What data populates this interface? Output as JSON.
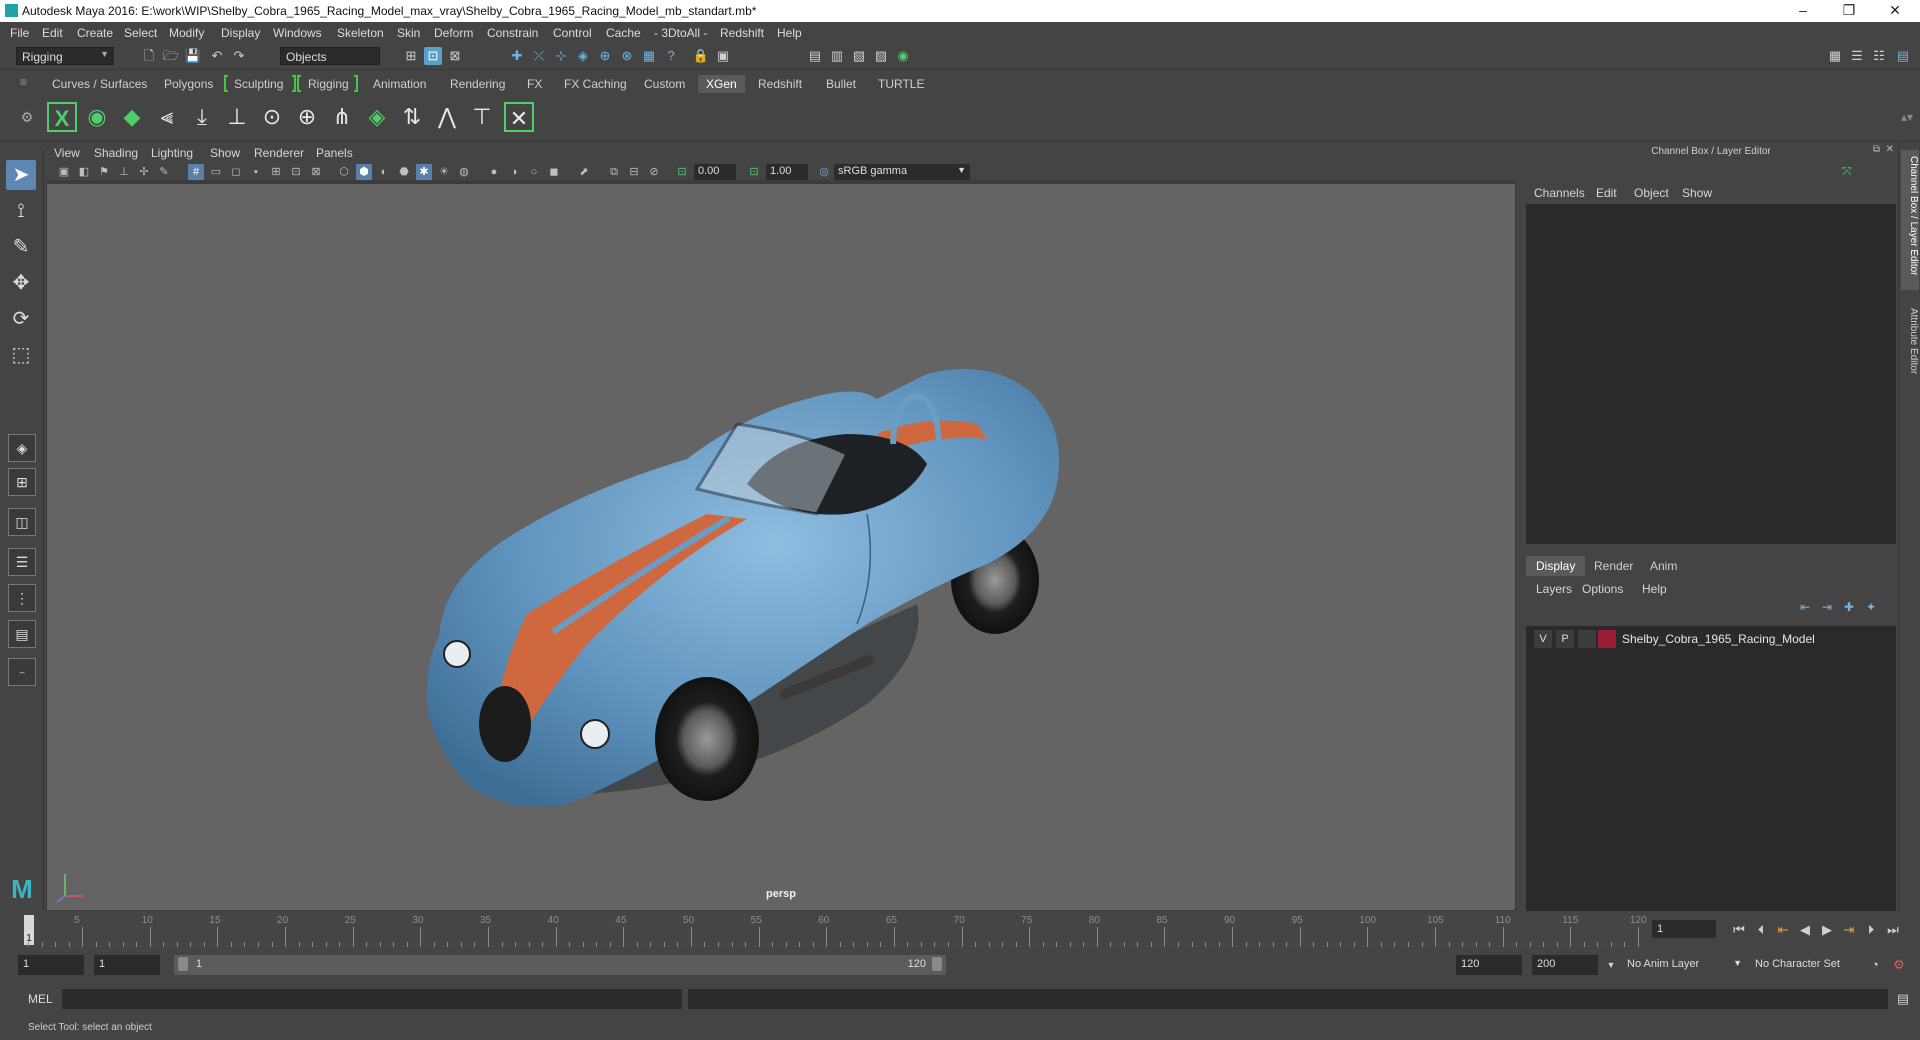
{
  "title": "Autodesk Maya 2016: E:\\work\\WIP\\Shelby_Cobra_1965_Racing_Model_max_vray\\Shelby_Cobra_1965_Racing_Model_mb_standart.mb*",
  "window_controls": {
    "minimize": "–",
    "restore": "❐",
    "close": "✕"
  },
  "menu": [
    "File",
    "Edit",
    "Create",
    "Select",
    "Modify",
    "Display",
    "Windows",
    "Skeleton",
    "Skin",
    "Deform",
    "Constrain",
    "Control",
    "Cache",
    "- 3DtoAll -",
    "Redshift",
    "Help"
  ],
  "statusline": {
    "mode": "Rigging",
    "selection_mode": "Objects"
  },
  "shelf_tabs": [
    "Curves / Surfaces",
    "Polygons",
    "Sculpting",
    "Rigging",
    "Animation",
    "Rendering",
    "FX",
    "FX Caching",
    "Custom",
    "XGen",
    "Redshift",
    "Bullet",
    "TURTLE"
  ],
  "shelf_active": "XGen",
  "panel_menu": [
    "View",
    "Shading",
    "Lighting",
    "Show",
    "Renderer",
    "Panels"
  ],
  "panel_values": {
    "exposure": "0.00",
    "gamma": "1.00",
    "color_space": "sRGB gamma"
  },
  "viewport": {
    "camera": "persp",
    "background": "#646464"
  },
  "right_panel": {
    "title": "Channel Box / Layer Editor",
    "channel_menu": [
      "Channels",
      "Edit",
      "Object",
      "Show"
    ],
    "layer_tabs": [
      "Display",
      "Render",
      "Anim"
    ],
    "layer_tab_active": "Display",
    "layer_menu": [
      "Layers",
      "Options",
      "Help"
    ],
    "layers": [
      {
        "visible": "V",
        "playback": "P",
        "name": "Shelby_Cobra_1965_Racing_Model",
        "color": "#9b1c32"
      }
    ],
    "side_tabs": [
      "Channel Box / Layer Editor",
      "Attribute Editor"
    ]
  },
  "timeline": {
    "ticks": [
      "5",
      "10",
      "15",
      "20",
      "25",
      "30",
      "35",
      "40",
      "45",
      "50",
      "55",
      "60",
      "65",
      "70",
      "75",
      "80",
      "85",
      "90",
      "95",
      "100",
      "105",
      "110",
      "115",
      "120"
    ],
    "current_frame": "1",
    "current_field": "1"
  },
  "range": {
    "start": "1",
    "start_inner": "1",
    "slider_start": "1",
    "slider_end": "120",
    "end": "120",
    "end_outer": "200",
    "anim_layer": "No Anim Layer",
    "character_set": "No Character Set"
  },
  "command": {
    "language": "MEL"
  },
  "help_line": "Select Tool: select an object",
  "car_colors": {
    "body": "#6a9cc4",
    "stripe": "#d0683f"
  }
}
